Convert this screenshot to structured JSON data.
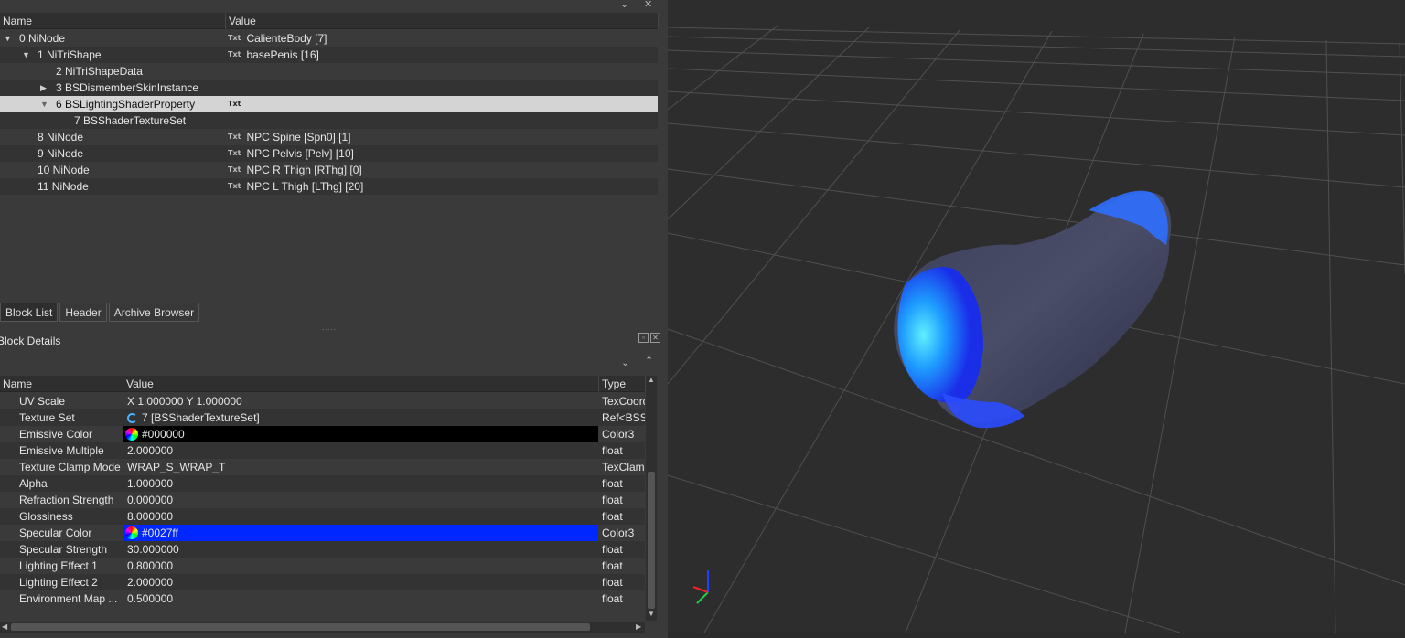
{
  "tree": {
    "col_name": "Name",
    "col_value": "Value",
    "rows": [
      {
        "name": "0 NiNode",
        "value": "CalienteBody [7]",
        "has_txt": true
      },
      {
        "name": "1 NiTriShape",
        "value": "basePenis [16]",
        "has_txt": true
      },
      {
        "name": "2 NiTriShapeData",
        "value": "",
        "has_txt": false
      },
      {
        "name": "3 BSDismemberSkinInstance",
        "value": "",
        "has_txt": false
      },
      {
        "name": "6 BSLightingShaderProperty",
        "value": "",
        "has_txt": true
      },
      {
        "name": "7 BSShaderTextureSet",
        "value": "",
        "has_txt": false
      },
      {
        "name": "8 NiNode",
        "value": "NPC Spine [Spn0] [1]",
        "has_txt": true
      },
      {
        "name": "9 NiNode",
        "value": "NPC Pelvis [Pelv] [10]",
        "has_txt": true
      },
      {
        "name": "10 NiNode",
        "value": "NPC R Thigh [RThg] [0]",
        "has_txt": true
      },
      {
        "name": "11 NiNode",
        "value": "NPC L Thigh [LThg] [20]",
        "has_txt": true
      }
    ],
    "txt_icon": "Txt"
  },
  "tabs": [
    "Block List",
    "Header",
    "Archive Browser"
  ],
  "splitter": "......",
  "block_details": {
    "title": "Block Details",
    "col_name": "Name",
    "col_value": "Value",
    "col_type": "Type",
    "rows": [
      {
        "name": "UV Scale",
        "value": "X 1.000000 Y 1.000000",
        "type": "TexCoord"
      },
      {
        "name": "Texture Set",
        "value": "7 [BSShaderTextureSet]",
        "type": "Ref<BSShaderTextureSet>"
      },
      {
        "name": "Emissive Color",
        "value": "#000000",
        "type": "Color3"
      },
      {
        "name": "Emissive Multiple",
        "value": "2.000000",
        "type": "float"
      },
      {
        "name": "Texture Clamp Mode",
        "value": "WRAP_S_WRAP_T",
        "type": "TexClampMode"
      },
      {
        "name": "Alpha",
        "value": "1.000000",
        "type": "float"
      },
      {
        "name": "Refraction Strength",
        "value": "0.000000",
        "type": "float"
      },
      {
        "name": "Glossiness",
        "value": "8.000000",
        "type": "float"
      },
      {
        "name": "Specular Color",
        "value": "#0027ff",
        "type": "Color3"
      },
      {
        "name": "Specular Strength",
        "value": "30.000000",
        "type": "float"
      },
      {
        "name": "Lighting Effect 1",
        "value": "0.800000",
        "type": "float"
      },
      {
        "name": "Lighting Effect 2",
        "value": "2.000000",
        "type": "float"
      },
      {
        "name": "Environment Map ...",
        "value": "0.500000",
        "type": "float"
      }
    ]
  },
  "colors": {
    "emissive": "#000000",
    "specular": "#0027ff",
    "selection": "#d4d4d4"
  }
}
